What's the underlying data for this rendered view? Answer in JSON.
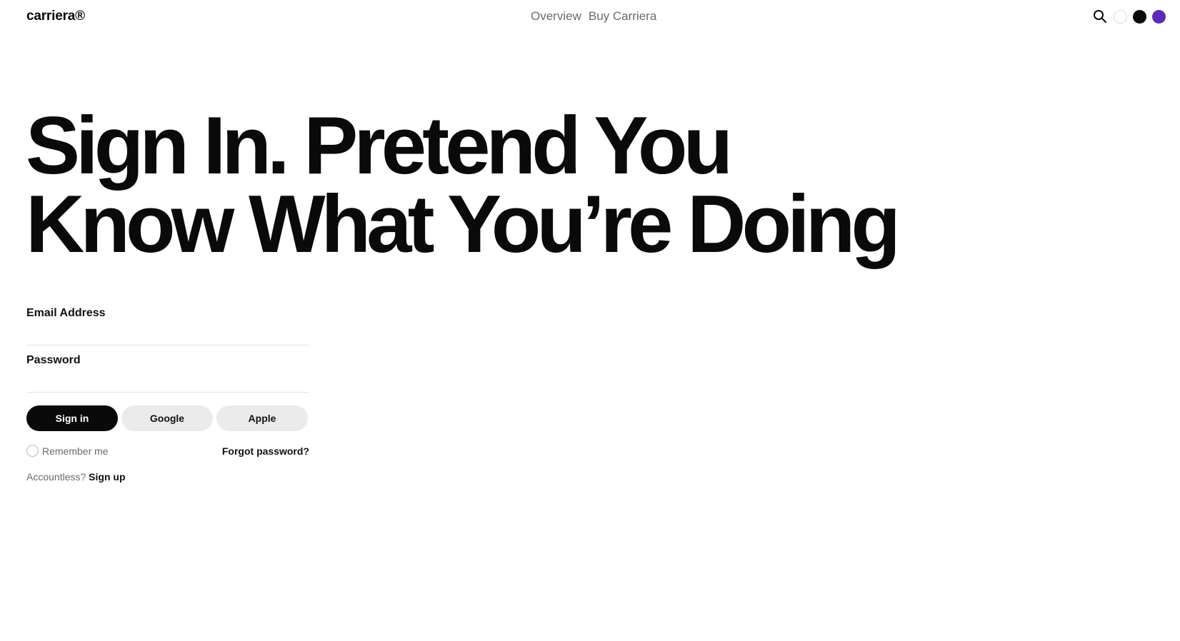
{
  "header": {
    "logo": "carriera®",
    "nav": [
      {
        "label": "Overview"
      },
      {
        "label": "Buy Carriera"
      }
    ],
    "search_icon": "search-icon",
    "theme_swatches": [
      {
        "name": "light",
        "color": "#ffffff"
      },
      {
        "name": "dark",
        "color": "#0a0a0a"
      },
      {
        "name": "purple",
        "color": "#5b2bb8"
      }
    ]
  },
  "hero": {
    "line1": "Sign In. Pretend You",
    "line2": "Know What You’re Doing"
  },
  "form": {
    "email_label": "Email Address",
    "email_value": "",
    "password_label": "Password",
    "password_value": "",
    "sign_in_label": "Sign in",
    "google_label": "Google",
    "apple_label": "Apple",
    "remember_label": "Remember me",
    "forgot_label": "Forgot password?",
    "signup_prompt": "Accountless?",
    "signup_label": "Sign up"
  }
}
